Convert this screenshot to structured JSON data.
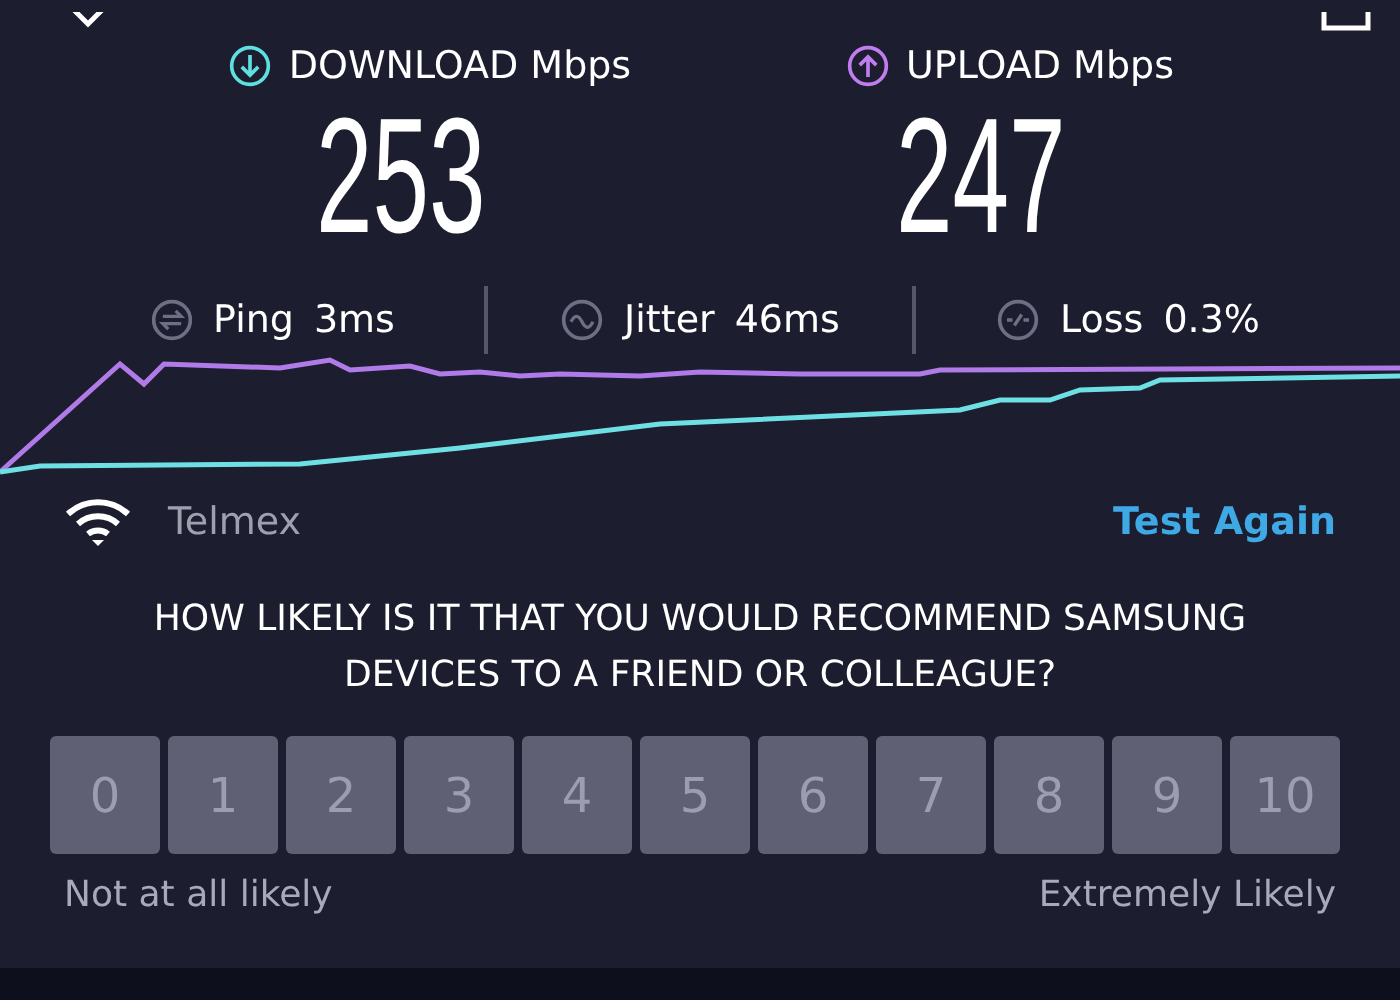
{
  "download": {
    "label": "DOWNLOAD Mbps",
    "value": "253"
  },
  "upload": {
    "label": "UPLOAD Mbps",
    "value": "247"
  },
  "metrics": [
    {
      "kind": "ping",
      "label": "Ping",
      "value": "3ms"
    },
    {
      "kind": "jitter",
      "label": "Jitter",
      "value": "46ms"
    },
    {
      "kind": "loss",
      "label": "Loss",
      "value": "0.3%"
    }
  ],
  "network": {
    "name": "Telmex",
    "action": "Test Again"
  },
  "survey": {
    "question": "HOW LIKELY IS IT THAT YOU WOULD RECOMMEND SAMSUNG DEVICES TO A FRIEND OR COLLEAGUE?",
    "scale": [
      "0",
      "1",
      "2",
      "3",
      "4",
      "5",
      "6",
      "7",
      "8",
      "9",
      "10"
    ],
    "low_label": "Not at all likely",
    "high_label": "Extremely Likely"
  }
}
